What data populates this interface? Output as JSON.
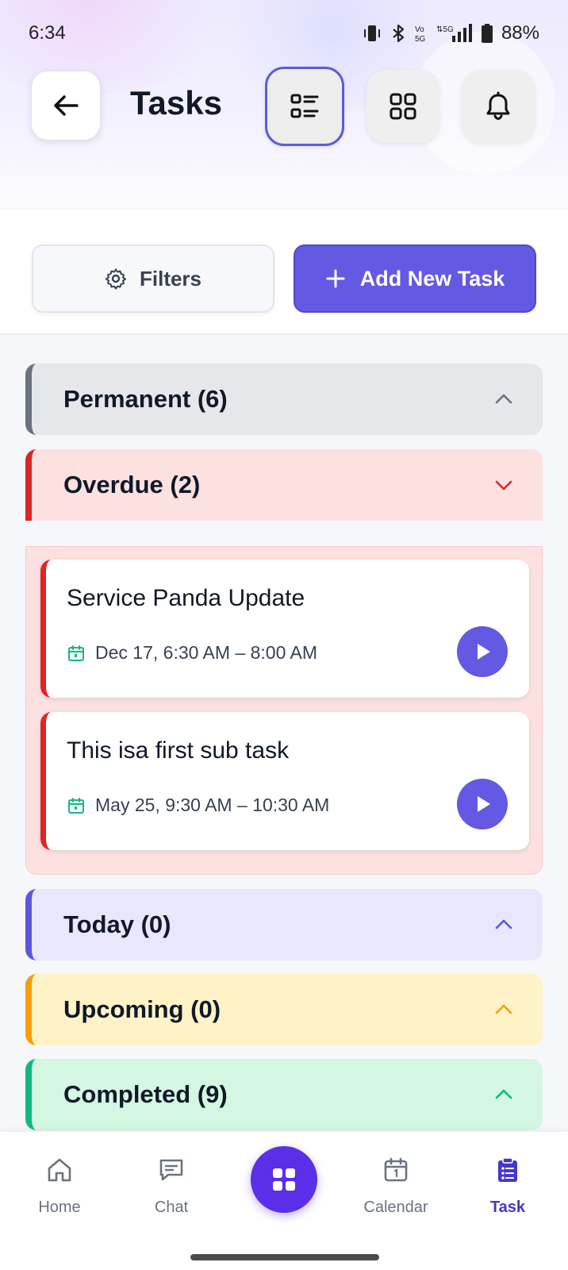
{
  "status_bar": {
    "time": "6:34",
    "battery": "88%",
    "network_label": "5G",
    "volte_label": "Vo 5G"
  },
  "header": {
    "title": "Tasks"
  },
  "actions": {
    "filters_label": "Filters",
    "add_label": "Add New Task"
  },
  "sections": {
    "permanent": "Permanent (6)",
    "overdue": "Overdue (2)",
    "today": "Today (0)",
    "upcoming": "Upcoming (0)",
    "completed": "Completed (9)"
  },
  "tasks": [
    {
      "title": "Service Panda Update",
      "time": "Dec 17, 6:30 AM – 8:00 AM"
    },
    {
      "title": "This isa first sub task",
      "time": "May 25, 9:30 AM – 10:30 AM"
    }
  ],
  "nav": {
    "home": "Home",
    "chat": "Chat",
    "calendar": "Calendar",
    "task": "Task"
  },
  "colors": {
    "accent": "#6359e3",
    "overdue": "#dc2626",
    "today": "#5b57d9",
    "upcoming": "#f59e0b",
    "completed": "#10b981",
    "permanent": "#6b7280"
  }
}
